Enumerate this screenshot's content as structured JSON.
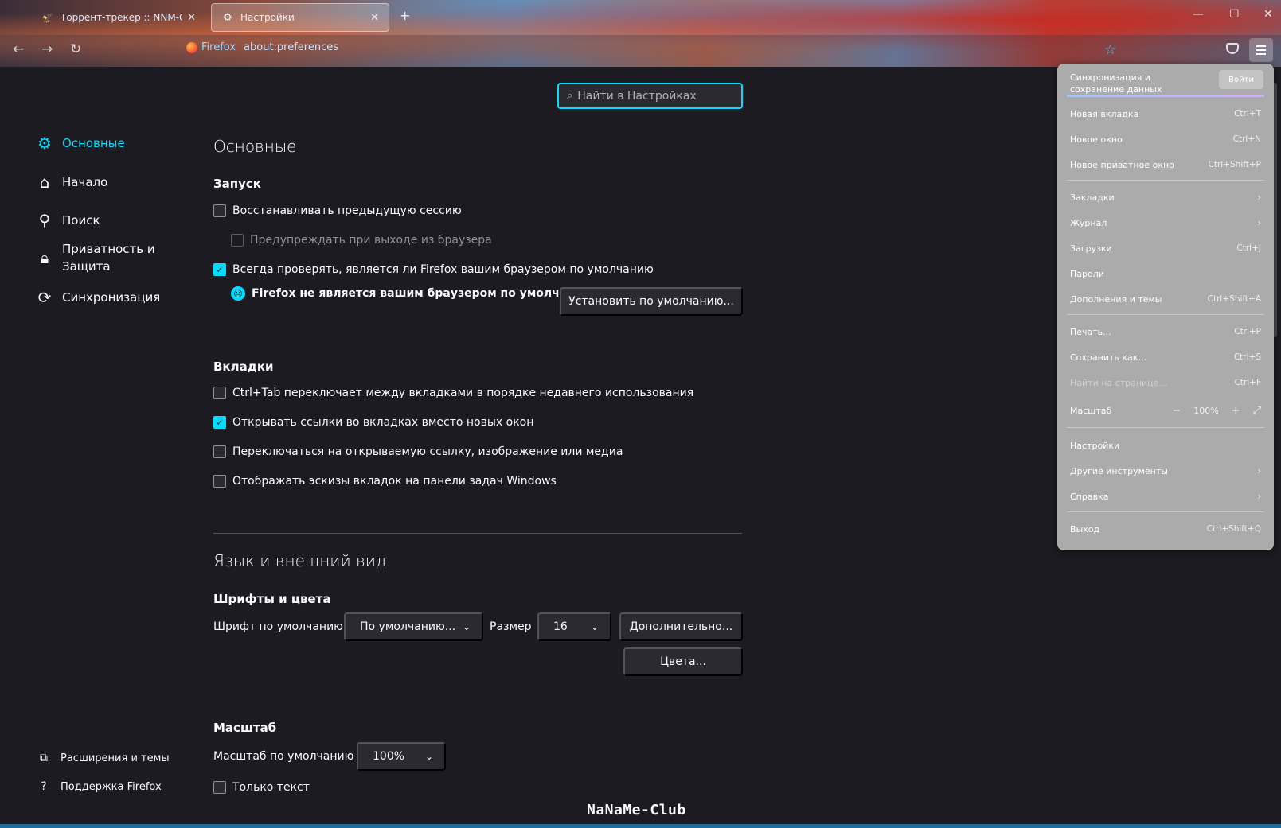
{
  "tabs": [
    {
      "title": "Торрент-трекер :: NNM-Club",
      "icon": "tracker-favicon",
      "active": false
    },
    {
      "title": "Настройки",
      "icon": "gear-icon",
      "active": true
    }
  ],
  "toolbar": {
    "identity": "Firefox",
    "url": "about:preferences"
  },
  "search": {
    "placeholder": "Найти в Настройках"
  },
  "sidebar": {
    "items": [
      {
        "label": "Основные",
        "icon": "gear-icon",
        "selected": true
      },
      {
        "label": "Начало",
        "icon": "home-icon"
      },
      {
        "label": "Поиск",
        "icon": "search-icon"
      },
      {
        "label_line1": "Приватность и",
        "label_line2": "Защита",
        "icon": "lock-icon"
      },
      {
        "label": "Синхронизация",
        "icon": "sync-icon"
      }
    ],
    "footer": [
      {
        "label": "Расширения и темы",
        "icon": "puzzle-icon"
      },
      {
        "label": "Поддержка Firefox",
        "icon": "help-icon"
      }
    ]
  },
  "main": {
    "title": "Основные",
    "startup": {
      "heading": "Запуск",
      "restore_session": {
        "label": "Восстанавливать предыдущую сессию",
        "checked": false
      },
      "warn_on_quit": {
        "label": "Предупреждать при выходе из браузера",
        "checked": false,
        "disabled": true
      },
      "check_default": {
        "label": "Всегда проверять, является ли Firefox вашим браузером по умолчанию",
        "checked": true
      },
      "not_default_text": "Firefox не является вашим браузером по умолчанию",
      "set_default_button": "Установить по умолчанию..."
    },
    "tabs_section": {
      "heading": "Вкладки",
      "options": [
        {
          "label": "Ctrl+Tab переключает между вкладками в порядке недавнего использования",
          "checked": false
        },
        {
          "label": "Открывать ссылки во вкладках вместо новых окон",
          "checked": true
        },
        {
          "label": "Переключаться на открываемую ссылку, изображение или медиа",
          "checked": false
        },
        {
          "label": "Отображать эскизы вкладок на панели задач Windows",
          "checked": false
        }
      ]
    },
    "language_title": "Язык и внешний вид",
    "fonts": {
      "heading": "Шрифты и цвета",
      "default_font_label": "Шрифт по умолчанию",
      "default_font_value": "По умолчанию...",
      "size_label": "Размер",
      "size_value": "16",
      "advanced_button": "Дополнительно...",
      "colors_button": "Цвета..."
    },
    "zoom": {
      "heading": "Масштаб",
      "default_zoom_label": "Масштаб по умолчанию",
      "default_zoom_value": "100%",
      "text_only": {
        "label": "Только текст",
        "checked": false
      }
    }
  },
  "app_menu": {
    "sync_text": "Синхронизация и сохранение данных",
    "sign_in": "Войти",
    "items": [
      {
        "label": "Новая вкладка",
        "shortcut": "Ctrl+T"
      },
      {
        "label": "Новое окно",
        "shortcut": "Ctrl+N"
      },
      {
        "label": "Новое приватное окно",
        "shortcut": "Ctrl+Shift+P"
      },
      {
        "label": "Закладки",
        "submenu": true
      },
      {
        "label": "Журнал",
        "submenu": true
      },
      {
        "label": "Загрузки",
        "shortcut": "Ctrl+J"
      },
      {
        "label": "Пароли",
        "shortcut": ""
      },
      {
        "label": "Дополнения и темы",
        "shortcut": "Ctrl+Shift+A"
      },
      {
        "label": "Печать...",
        "shortcut": "Ctrl+P"
      },
      {
        "label": "Сохранить как...",
        "shortcut": "Ctrl+S"
      },
      {
        "label": "Найти на странице...",
        "shortcut": "Ctrl+F",
        "disabled": true
      },
      {
        "label": "Масштаб",
        "zoom": "100%",
        "minus": "−",
        "plus": "+"
      },
      {
        "label": "Настройки",
        "shortcut": ""
      },
      {
        "label": "Другие инструменты",
        "submenu": true
      },
      {
        "label": "Справка",
        "submenu": true
      },
      {
        "label": "Выход",
        "shortcut": "Ctrl+Shift+Q"
      }
    ]
  },
  "watermark": "NaNaMe-Club",
  "colors": {
    "accent": "#00ddff",
    "background": "#1c1b22",
    "surface": "#2b2a33",
    "menu_bg": "#ababab"
  }
}
